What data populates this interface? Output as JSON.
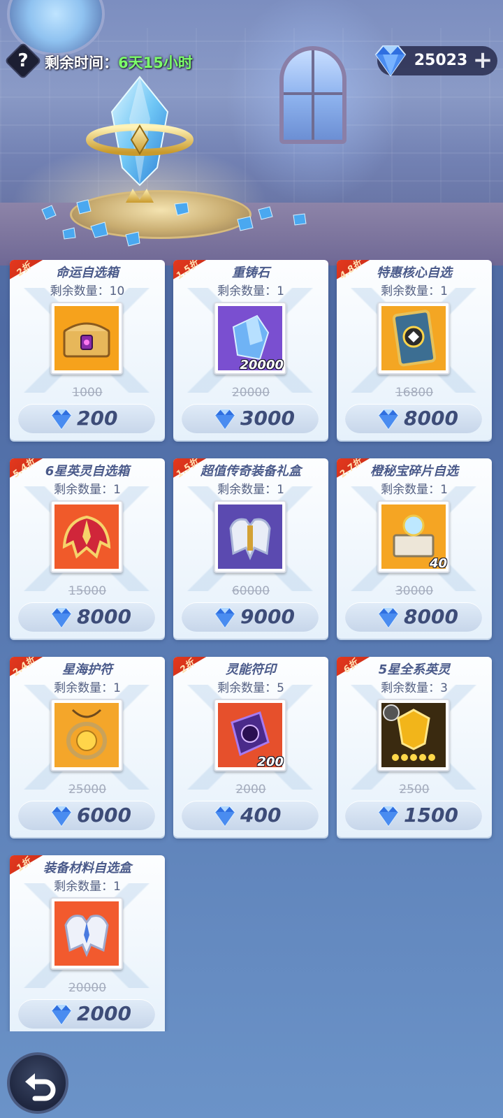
{
  "hud": {
    "help_glyph": "?",
    "timer_label": "剩余时间：",
    "timer_value": "6天15小时",
    "currency_value": "25023",
    "currency_plus": "+"
  },
  "items": [
    {
      "discount": "2折",
      "name": "命运自选箱",
      "stock": "剩余数量：10",
      "icon": "chest-icon",
      "qty": "",
      "original": "1000",
      "price": "200"
    },
    {
      "discount": "1.5折",
      "name": "重铸石",
      "stock": "剩余数量：1",
      "icon": "recast-stone-icon",
      "qty": "20000",
      "original": "20000",
      "price": "3000"
    },
    {
      "discount": "4.8折",
      "name": "特惠核心自选",
      "stock": "剩余数量：1",
      "icon": "core-card-icon",
      "qty": "",
      "original": "16800",
      "price": "8000"
    },
    {
      "discount": "5.4折",
      "name": "6星英灵自选箱",
      "stock": "剩余数量：1",
      "icon": "hero-helmet-icon",
      "qty": "",
      "original": "15000",
      "price": "8000"
    },
    {
      "discount": "1.5折",
      "name": "超值传奇装备礼盒",
      "stock": "剩余数量：1",
      "icon": "legend-armor-icon",
      "qty": "",
      "original": "60000",
      "price": "9000"
    },
    {
      "discount": "2.7折",
      "name": "橙秘宝碎片自选",
      "stock": "剩余数量：1",
      "icon": "treasure-fragment-icon",
      "qty": "40",
      "original": "30000",
      "price": "8000"
    },
    {
      "discount": "2.4折",
      "name": "星海护符",
      "stock": "剩余数量：1",
      "icon": "amulet-icon",
      "qty": "",
      "original": "25000",
      "price": "6000"
    },
    {
      "discount": "2折",
      "name": "灵能符印",
      "stock": "剩余数量：5",
      "icon": "psionic-seal-icon",
      "qty": "200",
      "original": "2000",
      "price": "400"
    },
    {
      "discount": "6折",
      "name": "5星全系英灵",
      "stock": "剩余数量：3",
      "icon": "five-star-hero-icon",
      "qty": "",
      "original": "2500",
      "price": "1500"
    },
    {
      "discount": "1折",
      "name": "装备材料自选盒",
      "stock": "剩余数量：1",
      "icon": "equipment-material-icon",
      "qty": "",
      "original": "20000",
      "price": "2000"
    }
  ],
  "colors": {
    "accent_ribbon": "#e63a1f",
    "timer_green": "#7dff6a",
    "price_text": "#3d4c78",
    "gem_blue": "#2f6fe0"
  }
}
